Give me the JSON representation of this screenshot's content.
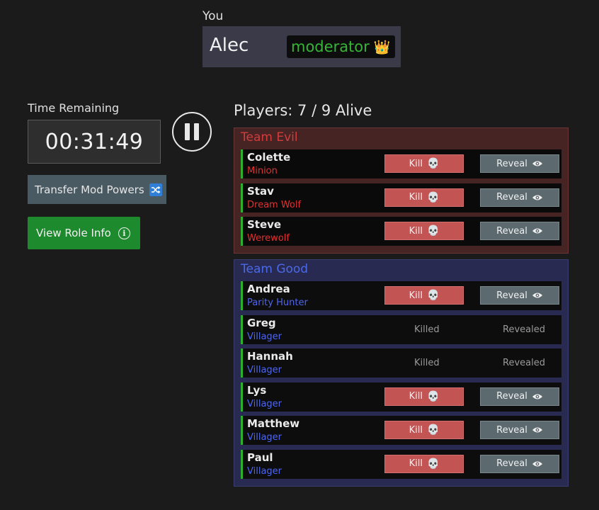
{
  "you": {
    "label": "You",
    "name": "Alec",
    "badge": "moderator",
    "badge_icon": "crown-icon"
  },
  "timer": {
    "label": "Time Remaining",
    "value": "00:31:49"
  },
  "buttons": {
    "transfer": "Transfer Mod Powers",
    "view_role": "View Role Info"
  },
  "players": {
    "title": "Players: 7 / 9 Alive",
    "kill_label": "Kill",
    "reveal_label": "Reveal",
    "killed_label": "Killed",
    "revealed_label": "Revealed"
  },
  "teams": [
    {
      "name": "Team Evil",
      "color": "#d23c3c",
      "players": [
        {
          "name": "Colette",
          "role": "Minion",
          "alive": true
        },
        {
          "name": "Stav",
          "role": "Dream Wolf",
          "alive": true
        },
        {
          "name": "Steve",
          "role": "Werewolf",
          "alive": true
        }
      ]
    },
    {
      "name": "Team Good",
      "color": "#4a6ae8",
      "players": [
        {
          "name": "Andrea",
          "role": "Parity Hunter",
          "alive": true
        },
        {
          "name": "Greg",
          "role": "Villager",
          "alive": false
        },
        {
          "name": "Hannah",
          "role": "Villager",
          "alive": false
        },
        {
          "name": "Lys",
          "role": "Villager",
          "alive": true
        },
        {
          "name": "Matthew",
          "role": "Villager",
          "alive": true
        },
        {
          "name": "Paul",
          "role": "Villager",
          "alive": true
        }
      ]
    }
  ],
  "colors": {
    "kill_button": "#c25454",
    "reveal_button": "#5c6a70",
    "view_role_button": "#1e8a2e",
    "alive_indicator": "#2bb12b"
  }
}
